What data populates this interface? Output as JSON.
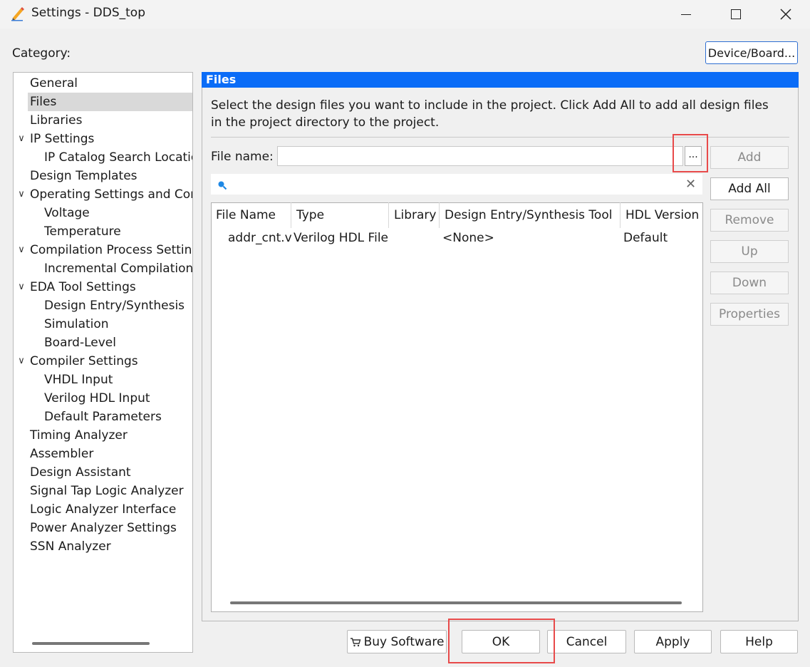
{
  "window": {
    "title": "Settings - DDS_top",
    "minimize_icon": "minimize-icon",
    "maximize_icon": "maximize-icon",
    "close_icon": "close-icon"
  },
  "category_label": "Category:",
  "device_board_label": "Device/Board...",
  "tree": {
    "items": [
      {
        "label": "General",
        "level": 0,
        "expandable": false,
        "selected": false
      },
      {
        "label": "Files",
        "level": 0,
        "expandable": false,
        "selected": true
      },
      {
        "label": "Libraries",
        "level": 0,
        "expandable": false,
        "selected": false
      },
      {
        "label": "IP Settings",
        "level": 0,
        "expandable": true,
        "selected": false
      },
      {
        "label": "IP Catalog Search Locations",
        "level": 1,
        "expandable": false,
        "selected": false
      },
      {
        "label": "Design Templates",
        "level": 0,
        "expandable": false,
        "selected": false
      },
      {
        "label": "Operating Settings and Conditions",
        "level": 0,
        "expandable": true,
        "selected": false
      },
      {
        "label": "Voltage",
        "level": 1,
        "expandable": false,
        "selected": false
      },
      {
        "label": "Temperature",
        "level": 1,
        "expandable": false,
        "selected": false
      },
      {
        "label": "Compilation Process Settings",
        "level": 0,
        "expandable": true,
        "selected": false
      },
      {
        "label": "Incremental Compilation",
        "level": 1,
        "expandable": false,
        "selected": false
      },
      {
        "label": "EDA Tool Settings",
        "level": 0,
        "expandable": true,
        "selected": false
      },
      {
        "label": "Design Entry/Synthesis",
        "level": 1,
        "expandable": false,
        "selected": false
      },
      {
        "label": "Simulation",
        "level": 1,
        "expandable": false,
        "selected": false
      },
      {
        "label": "Board-Level",
        "level": 1,
        "expandable": false,
        "selected": false
      },
      {
        "label": "Compiler Settings",
        "level": 0,
        "expandable": true,
        "selected": false
      },
      {
        "label": "VHDL Input",
        "level": 1,
        "expandable": false,
        "selected": false
      },
      {
        "label": "Verilog HDL Input",
        "level": 1,
        "expandable": false,
        "selected": false
      },
      {
        "label": "Default Parameters",
        "level": 1,
        "expandable": false,
        "selected": false
      },
      {
        "label": "Timing Analyzer",
        "level": 0,
        "expandable": false,
        "selected": false
      },
      {
        "label": "Assembler",
        "level": 0,
        "expandable": false,
        "selected": false
      },
      {
        "label": "Design Assistant",
        "level": 0,
        "expandable": false,
        "selected": false
      },
      {
        "label": "Signal Tap Logic Analyzer",
        "level": 0,
        "expandable": false,
        "selected": false
      },
      {
        "label": "Logic Analyzer Interface",
        "level": 0,
        "expandable": false,
        "selected": false
      },
      {
        "label": "Power Analyzer Settings",
        "level": 0,
        "expandable": false,
        "selected": false
      },
      {
        "label": "SSN Analyzer",
        "level": 0,
        "expandable": false,
        "selected": false
      }
    ]
  },
  "files_panel": {
    "header": "Files",
    "description": "Select the design files you want to include in the project. Click Add All to add all design files in the project directory to the project.",
    "file_name_label": "File name:",
    "file_name_value": "",
    "browse_label": "...",
    "search_value": "",
    "columns": [
      "File Name",
      "Type",
      "Library",
      "Design Entry/Synthesis Tool",
      "HDL Version"
    ],
    "rows": [
      {
        "file_name": "addr_cnt.v",
        "type": "Verilog HDL File",
        "library": "",
        "tool": "<None>",
        "hdl_version": "Default"
      }
    ],
    "buttons": {
      "add": "Add",
      "add_all": "Add All",
      "remove": "Remove",
      "up": "Up",
      "down": "Down",
      "properties": "Properties"
    }
  },
  "footer": {
    "buy_software": "Buy Software",
    "ok": "OK",
    "cancel": "Cancel",
    "apply": "Apply",
    "help": "Help"
  },
  "colors": {
    "panel_header": "#0a6cf7",
    "highlight": "#e84a4a"
  }
}
